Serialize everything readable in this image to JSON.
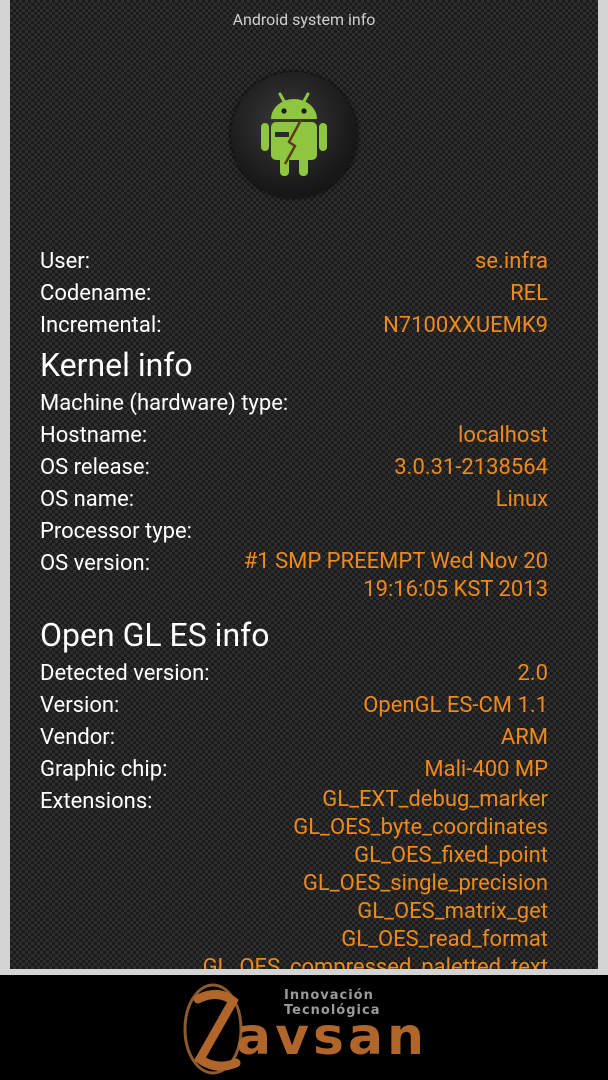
{
  "app": {
    "title": "Android system info"
  },
  "system": [
    {
      "label": "User:",
      "value": "se.infra"
    },
    {
      "label": "Codename:",
      "value": "REL"
    },
    {
      "label": "Incremental:",
      "value": "N7100XXUEMK9"
    }
  ],
  "kernel": {
    "heading": "Kernel info",
    "rows": [
      {
        "label": "Machine (hardware) type:",
        "value": ""
      },
      {
        "label": "Hostname:",
        "value": "localhost"
      },
      {
        "label": "OS release:",
        "value": "3.0.31-2138564"
      },
      {
        "label": "OS name:",
        "value": "Linux"
      },
      {
        "label": "Processor type:",
        "value": ""
      }
    ],
    "os_version": {
      "label": "OS version:",
      "line1": "#1 SMP PREEMPT Wed Nov 20",
      "line2": "19:16:05 KST 2013"
    }
  },
  "opengl": {
    "heading": "Open GL ES info",
    "rows": [
      {
        "label": "Detected version:",
        "value": "2.0"
      },
      {
        "label": "Version:",
        "value": "OpenGL ES-CM 1.1"
      },
      {
        "label": "Vendor:",
        "value": "ARM"
      },
      {
        "label": "Graphic chip:",
        "value": "Mali-400 MP"
      }
    ],
    "extensions_label": "Extensions:",
    "extensions": [
      "GL_EXT_debug_marker",
      "GL_OES_byte_coordinates",
      "GL_OES_fixed_point",
      "GL_OES_single_precision",
      "GL_OES_matrix_get",
      "GL_OES_read_format",
      "GL_OES_compressed_paletted_text"
    ]
  },
  "watermark": {
    "line1": "Innovación",
    "line2": "Tecnológica",
    "brand": "avsan"
  },
  "colors": {
    "accent": "#ee8a1b",
    "text": "#ffffff",
    "panel": "#1b1b1b",
    "frame": "#d4d4d4"
  },
  "icons": {
    "logo": "android-robot-icon"
  }
}
